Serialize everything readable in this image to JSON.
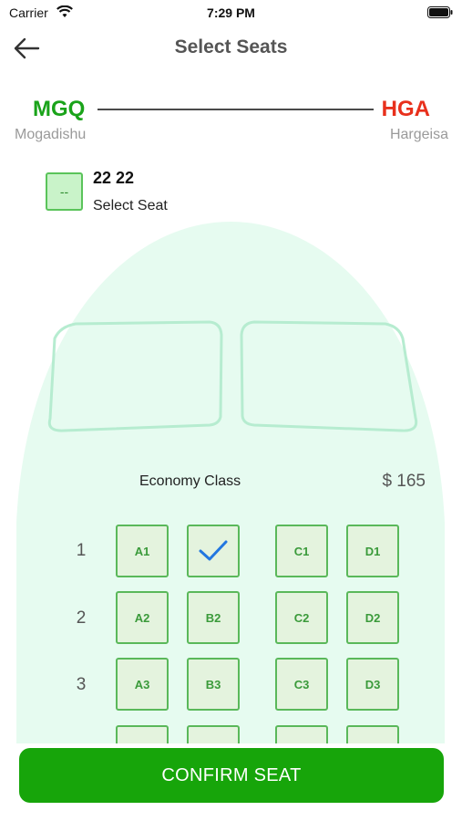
{
  "status_bar": {
    "carrier": "Carrier",
    "time": "7:29 PM"
  },
  "header": {
    "title": "Select Seats"
  },
  "route": {
    "from_code": "MGQ",
    "from_city": "Mogadishu",
    "to_code": "HGA",
    "to_city": "Hargeisa",
    "from_color": "#1aa31a",
    "to_color": "#e8301c"
  },
  "passenger": {
    "seat_value": "--",
    "name": "22 22",
    "status": "Select Seat"
  },
  "cabin": {
    "class_name": "Economy Class",
    "price": "$ 165"
  },
  "rows": [
    {
      "number": "1",
      "seats": [
        {
          "label": "A1",
          "selected": false
        },
        {
          "label": "",
          "selected": true
        },
        {
          "label": "C1",
          "selected": false
        },
        {
          "label": "D1",
          "selected": false
        }
      ]
    },
    {
      "number": "2",
      "seats": [
        {
          "label": "A2",
          "selected": false
        },
        {
          "label": "B2",
          "selected": false
        },
        {
          "label": "C2",
          "selected": false
        },
        {
          "label": "D2",
          "selected": false
        }
      ]
    },
    {
      "number": "3",
      "seats": [
        {
          "label": "A3",
          "selected": false
        },
        {
          "label": "B3",
          "selected": false
        },
        {
          "label": "C3",
          "selected": false
        },
        {
          "label": "D3",
          "selected": false
        }
      ]
    }
  ],
  "confirm_button": {
    "label": "CONFIRM SEAT",
    "color": "#17a50a"
  },
  "colors": {
    "plane_body": "#e6fbf0",
    "seat_border": "#5ab85a",
    "seat_fill": "#e4f3de",
    "check": "#2277e0"
  }
}
